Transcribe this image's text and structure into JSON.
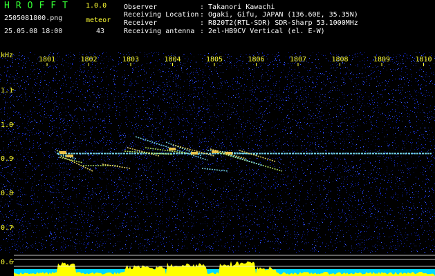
{
  "app": {
    "title": "HROFFT",
    "version": "1.0.0"
  },
  "file": {
    "name": "2505081800.png",
    "datetime": "25.05.08 18:00"
  },
  "meteor": {
    "label": "meteor",
    "count": "43"
  },
  "station": [
    {
      "label": "Observer",
      "value": ": Takanori Kawachi"
    },
    {
      "label": "Receiving Location",
      "value": ": Ogaki, Gifu, JAPAN (136.60E, 35.35N)"
    },
    {
      "label": "Receiver",
      "value": ": R820T2(RTL-SDR) SDR-Sharp 53.1000MHz"
    },
    {
      "label": "Receiving antenna",
      "value": ": 2el-HB9CV Vertical (el. E-W)"
    }
  ],
  "axis": {
    "unit": "kHz",
    "time_ticks": [
      "1801",
      "1802",
      "1803",
      "1804",
      "1805",
      "1806",
      "1807",
      "1808",
      "1809",
      "1810"
    ],
    "freq_ticks": [
      "1.1",
      "1.0",
      "0.9",
      "0.8",
      "0.7",
      "0.6"
    ]
  },
  "colors": {
    "background": "#000000",
    "title": "#33ff33",
    "labels": "#ffff33",
    "noise": "#0a1a9a",
    "carrier": "#7fe8ff",
    "level_bar": "#ffff00",
    "level_base": "#00d8ff"
  }
}
